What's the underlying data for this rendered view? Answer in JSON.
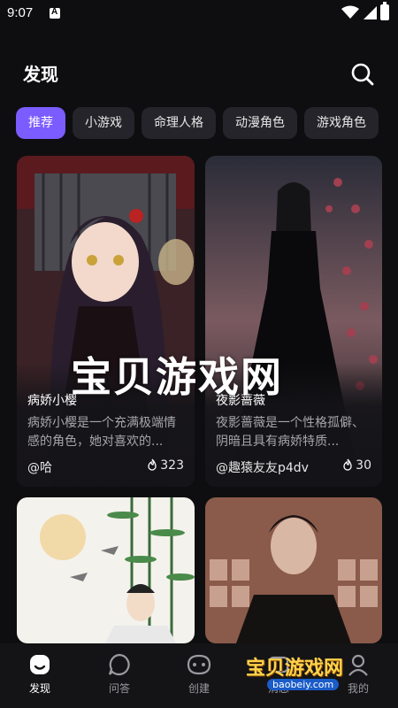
{
  "status_bar": {
    "time": "9:07"
  },
  "header": {
    "title": "发现"
  },
  "chips": [
    "推荐",
    "小游戏",
    "命理人格",
    "动漫角色",
    "游戏角色"
  ],
  "cards": [
    {
      "name": "病娇小樱",
      "desc": "病娇小樱是一个充满极端情感的角色，她对喜欢的...",
      "author": "@哈",
      "likes": "323"
    },
    {
      "name": "夜影蔷薇",
      "desc": "夜影蔷薇是一个性格孤僻、阴暗且具有病娇特质...",
      "author": "@趣猿友友p4dv",
      "likes": "30"
    }
  ],
  "watermark": "宝贝游戏网",
  "logo_watermark": {
    "text": "宝贝游戏网",
    "url": "baobeiy.com"
  },
  "bottom_nav": [
    "发现",
    "问答",
    "创建",
    "消息",
    "我的"
  ],
  "colors": {
    "accent": "#7a5cff",
    "background": "#0e0e10"
  }
}
